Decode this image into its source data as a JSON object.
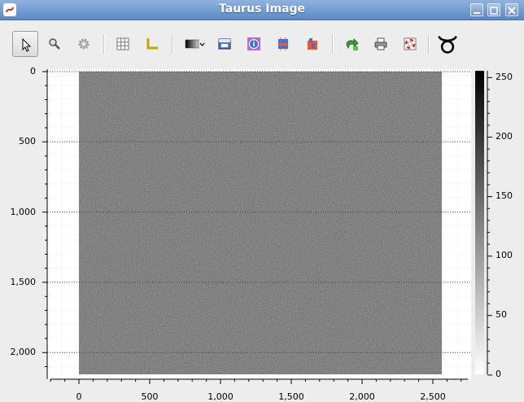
{
  "window": {
    "title": "Taurus Image"
  },
  "toolbar": {
    "tools": [
      {
        "name": "select-tool-button",
        "icon": "cursor-arrow-icon"
      },
      {
        "name": "zoom-tool-button",
        "icon": "magnifier-icon"
      },
      {
        "name": "settings-tool-button",
        "icon": "gear-icon"
      },
      {
        "name": "grid-toggle-button",
        "icon": "grid-icon"
      },
      {
        "name": "axes-toggle-button",
        "icon": "axes-icon"
      },
      {
        "name": "colormap-button",
        "icon": "colormap-gradient-icon"
      },
      {
        "name": "image-contrast-button",
        "icon": "contrast-icon"
      },
      {
        "name": "info-button",
        "icon": "info-icon"
      },
      {
        "name": "cross-section-x-button",
        "icon": "xsection-icon"
      },
      {
        "name": "cross-section-y-button",
        "icon": "ysection-icon"
      },
      {
        "name": "export-button",
        "icon": "export-icon"
      },
      {
        "name": "print-button",
        "icon": "printer-icon"
      },
      {
        "name": "help-button",
        "icon": "lifebuoy-icon"
      },
      {
        "name": "taurus-logo",
        "icon": "taurus-icon"
      }
    ]
  },
  "plot": {
    "y_ticks": [
      "0",
      "500",
      "1,000",
      "1,500",
      "2,000"
    ],
    "x_ticks": [
      "0",
      "500",
      "1,000",
      "1,500",
      "2,000",
      "2,500"
    ],
    "colorbar_ticks": [
      "250",
      "200",
      "150",
      "100",
      "50",
      "0"
    ],
    "colormap": "grayscale",
    "image_description": "noise"
  }
}
